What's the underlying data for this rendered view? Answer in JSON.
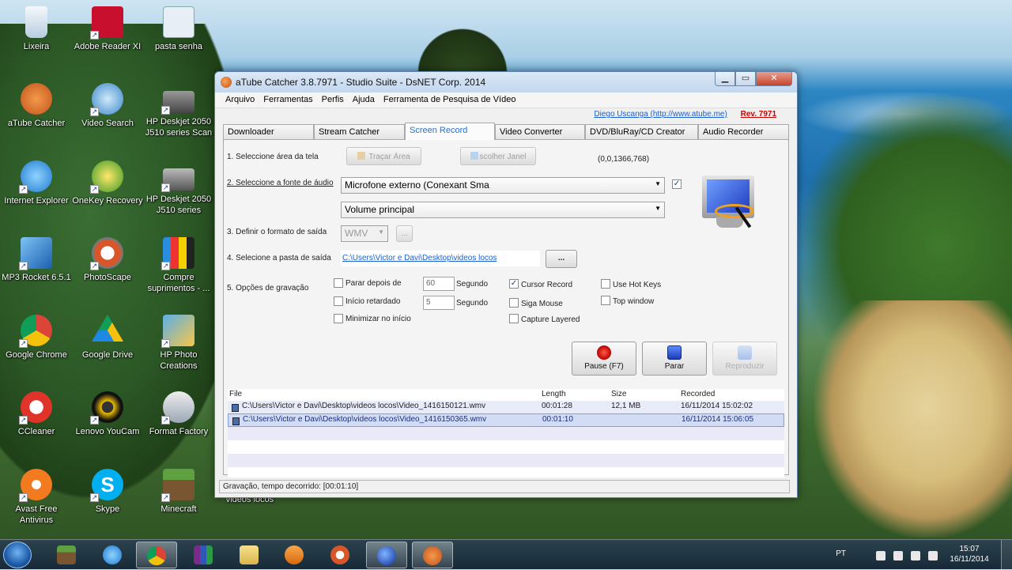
{
  "desktop": {
    "icons": [
      {
        "label": "Lixeira",
        "icon": "recycle-bin-icon"
      },
      {
        "label": "Adobe Reader XI",
        "icon": "adobe-reader-icon"
      },
      {
        "label": "pasta senha",
        "icon": "settings-document-icon"
      },
      {
        "label": "aTube Catcher",
        "icon": "atube-catcher-icon"
      },
      {
        "label": "Video Search",
        "icon": "video-search-icon"
      },
      {
        "label": "HP Deskjet 2050 J510 series Scan",
        "icon": "scanner-icon"
      },
      {
        "label": "Internet Explorer",
        "icon": "internet-explorer-icon"
      },
      {
        "label": "OneKey Recovery",
        "icon": "onekey-recovery-icon"
      },
      {
        "label": "HP Deskjet 2050 J510 series",
        "icon": "printer-icon"
      },
      {
        "label": "MP3 Rocket 6.5.1",
        "icon": "mp3-rocket-icon"
      },
      {
        "label": "PhotoScape",
        "icon": "photoscape-icon"
      },
      {
        "label": "Compre suprimentos - ...",
        "icon": "supplies-icon"
      },
      {
        "label": "Google Chrome",
        "icon": "chrome-icon"
      },
      {
        "label": "Google Drive",
        "icon": "google-drive-icon"
      },
      {
        "label": "HP Photo Creations",
        "icon": "hp-photo-icon"
      },
      {
        "label": "CCleaner",
        "icon": "ccleaner-icon"
      },
      {
        "label": "Lenovo YouCam",
        "icon": "youcam-icon"
      },
      {
        "label": "Format Factory",
        "icon": "format-factory-icon"
      },
      {
        "label": "Avast Free Antivirus",
        "icon": "avast-icon"
      },
      {
        "label": "Skype",
        "icon": "skype-icon"
      },
      {
        "label": "Minecraft",
        "icon": "minecraft-icon"
      },
      {
        "label": "videos locos",
        "icon": "folder-icon"
      }
    ]
  },
  "window": {
    "title": "aTube Catcher 3.8.7971 - Studio Suite - DsNET Corp. 2014",
    "menu": [
      "Arquivo",
      "Ferramentas",
      "Perfis",
      "Ajuda",
      "Ferramenta de Pesquisa de Vídeo"
    ],
    "author_link": "Diego Uscanga (http://www.atube.me)",
    "revision": "Rev. 7971",
    "tabs": [
      "Downloader",
      "Stream Catcher",
      "Screen Record",
      "Video Converter",
      "DVD/BluRay/CD Creator",
      "Audio Recorder"
    ],
    "active_tab": "Screen Record",
    "steps": {
      "s1": "1. Seleccione área da tela",
      "s2": "2. Seleccione a fonte de áudio",
      "s3": "3. Definir o formato de saída",
      "s4": "4. Selecione a pasta de saída",
      "s5": "5. Opções de gravação"
    },
    "trace_area_btn": "Traçar Área",
    "choose_window_btn": "scolher Janel",
    "area_coords": "(0,0,1366,768)",
    "audio_source": "Microfone externo (Conexant Sma",
    "audio_volume": "Volume principal",
    "format": "WMV",
    "browse_small": "...",
    "output_path": "C:\\Users\\Victor e Davi\\Desktop\\videos locos",
    "browse_btn": "...",
    "options": {
      "stop_after": "Parar depois de",
      "stop_after_value": "60",
      "unit1": "Segundo",
      "delayed_start": "Início retardado",
      "delayed_start_value": "5",
      "unit2": "Segundo",
      "minimize": "Minimizar no início",
      "cursor_record": "Cursor Record",
      "follow_mouse": "Siga Mouse",
      "capture_layered": "Capture Layered",
      "hot_keys": "Use Hot Keys",
      "top_window": "Top window"
    },
    "buttons": {
      "pause": "Pause (F7)",
      "stop": "Parar",
      "play": "Reproduzir"
    },
    "list": {
      "headers": [
        "File",
        "Length",
        "Size",
        "Recorded"
      ],
      "rows": [
        {
          "file": "C:\\Users\\Victor e Davi\\Desktop\\videos locos\\Video_1416150121.wmv",
          "length": "00:01:28",
          "size": "12,1 MB",
          "recorded": "16/11/2014 15:02:02"
        },
        {
          "file": "C:\\Users\\Victor e Davi\\Desktop\\videos locos\\Video_1416150365.wmv",
          "length": "00:01:10",
          "size": "",
          "recorded": "16/11/2014 15:06:05"
        }
      ]
    },
    "status": "Gravação, tempo decorrido: [00:01:10]"
  },
  "taskbar": {
    "items": [
      "minecraft-icon",
      "internet-explorer-icon",
      "chrome-icon",
      "winrar-icon",
      "file-explorer-icon",
      "media-player-icon",
      "photoscape-icon",
      "globe-icon",
      "atube-catcher-icon"
    ],
    "lang": "PT",
    "time": "15:07",
    "date": "16/11/2014"
  },
  "colors": {
    "link": "#1a5fd0",
    "revision": "#cc0000",
    "selected_row": "#d2dcf4"
  }
}
